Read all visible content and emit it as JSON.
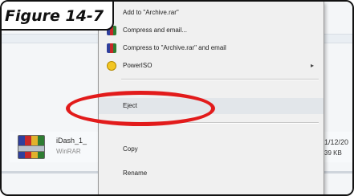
{
  "figure_label": "Figure 14-7",
  "context_menu": {
    "items": [
      {
        "label": "Add to \"Archive.rar\"",
        "icon": "none"
      },
      {
        "label": "Compress and email...",
        "icon": "winrar-icon"
      },
      {
        "label": "Compress to \"Archive.rar\" and email",
        "icon": "winrar-icon"
      },
      {
        "label": "PowerISO",
        "icon": "poweriso-icon",
        "submenu_arrow": "▸"
      },
      {
        "label": "Eject",
        "highlighted": true
      },
      {
        "label": "Copy"
      },
      {
        "label": "Rename"
      }
    ]
  },
  "file": {
    "name": "iDash_1_",
    "type": "WinRAR",
    "date": "1/12/20",
    "size": "39 KB"
  },
  "annotation": {
    "color": "#e21b1b"
  }
}
